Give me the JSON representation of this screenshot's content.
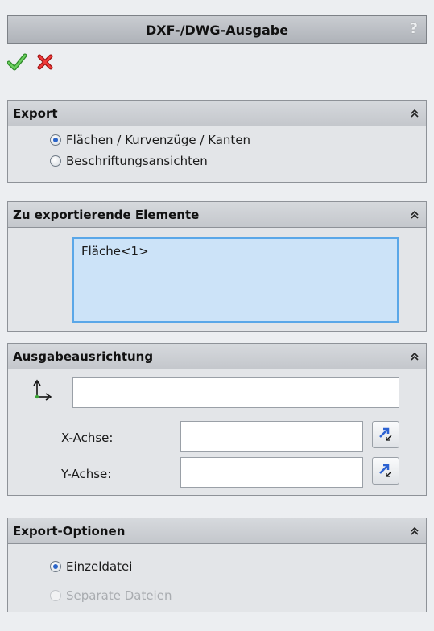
{
  "window": {
    "title": "DXF-/DWG-Ausgabe",
    "help_label": "?"
  },
  "actions": {
    "ok_icon": "checkmark-icon",
    "cancel_icon": "x-icon"
  },
  "export": {
    "title": "Export",
    "options": [
      {
        "label": "Flächen / Kurvenzüge / Kanten",
        "checked": true
      },
      {
        "label": "Beschriftungsansichten",
        "checked": false
      }
    ]
  },
  "elements": {
    "title": "Zu exportierende Elemente",
    "items": [
      "Fläche<1>"
    ]
  },
  "orientation": {
    "title": "Ausgabeausrichtung",
    "origin_value": "",
    "x_axis_label": "X-Achse:",
    "x_axis_value": "",
    "y_axis_label": "Y-Achse:",
    "y_axis_value": ""
  },
  "export_options": {
    "title": "Export-Optionen",
    "options": [
      {
        "label": "Einzeldatei",
        "checked": true,
        "enabled": true
      },
      {
        "label": "Separate Dateien",
        "checked": false,
        "enabled": false
      }
    ]
  },
  "colors": {
    "accent": "#2b64c8",
    "list_bg": "#cce3f8",
    "list_border": "#5aa7e8",
    "ok": "#3aa334",
    "cancel": "#d81e1e"
  }
}
